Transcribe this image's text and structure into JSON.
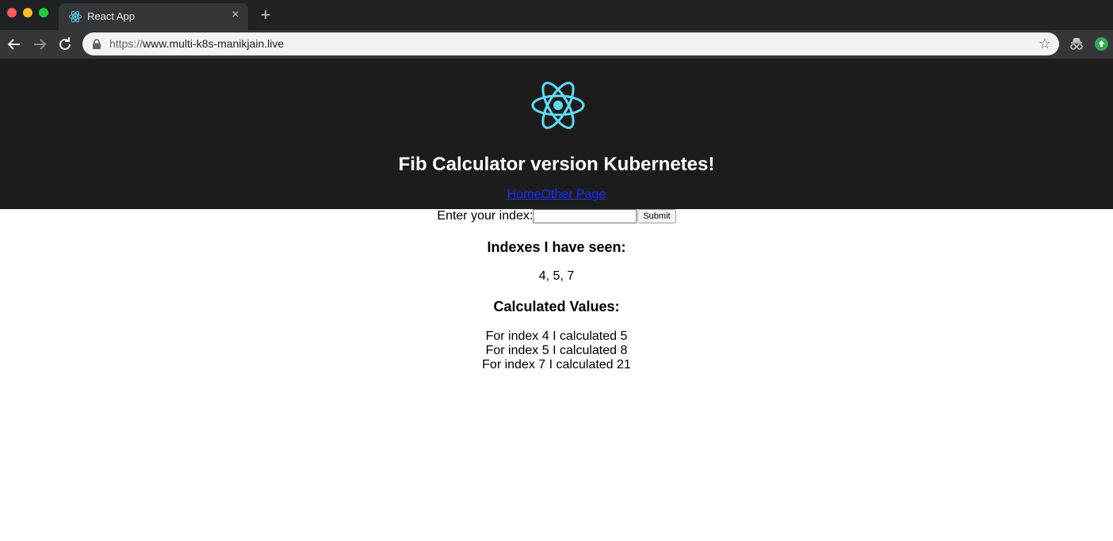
{
  "browser": {
    "tab_title": "React App",
    "tab_close": "×",
    "new_tab": "+",
    "url_scheme": "https://",
    "url_rest": "www.multi-k8s-manikjain.live",
    "star": "☆"
  },
  "header": {
    "title": "Fib Calculator version Kubernetes!",
    "nav": [
      {
        "label": "Home"
      },
      {
        "label": "Other Page"
      }
    ]
  },
  "form": {
    "label": "Enter your index:",
    "input_value": "",
    "submit_label": "Submit"
  },
  "seen": {
    "heading": "Indexes I have seen:",
    "list": "4, 5, 7"
  },
  "calculated": {
    "heading": "Calculated Values:",
    "items": [
      {
        "text": "For index 4 I calculated 5"
      },
      {
        "text": "For index 5 I calculated 8"
      },
      {
        "text": "For index 7 I calculated 21"
      }
    ]
  },
  "colors": {
    "header_bg": "#1c1c1c",
    "react_blue": "#61dafb",
    "link": "#1f2fff"
  },
  "icons": {
    "logo": "react-logo-icon",
    "lock": "lock-icon",
    "back": "arrow-back-icon",
    "forward": "arrow-forward-icon",
    "reload": "reload-icon",
    "star": "star-icon",
    "incognito": "incognito-icon",
    "update": "update-icon"
  }
}
